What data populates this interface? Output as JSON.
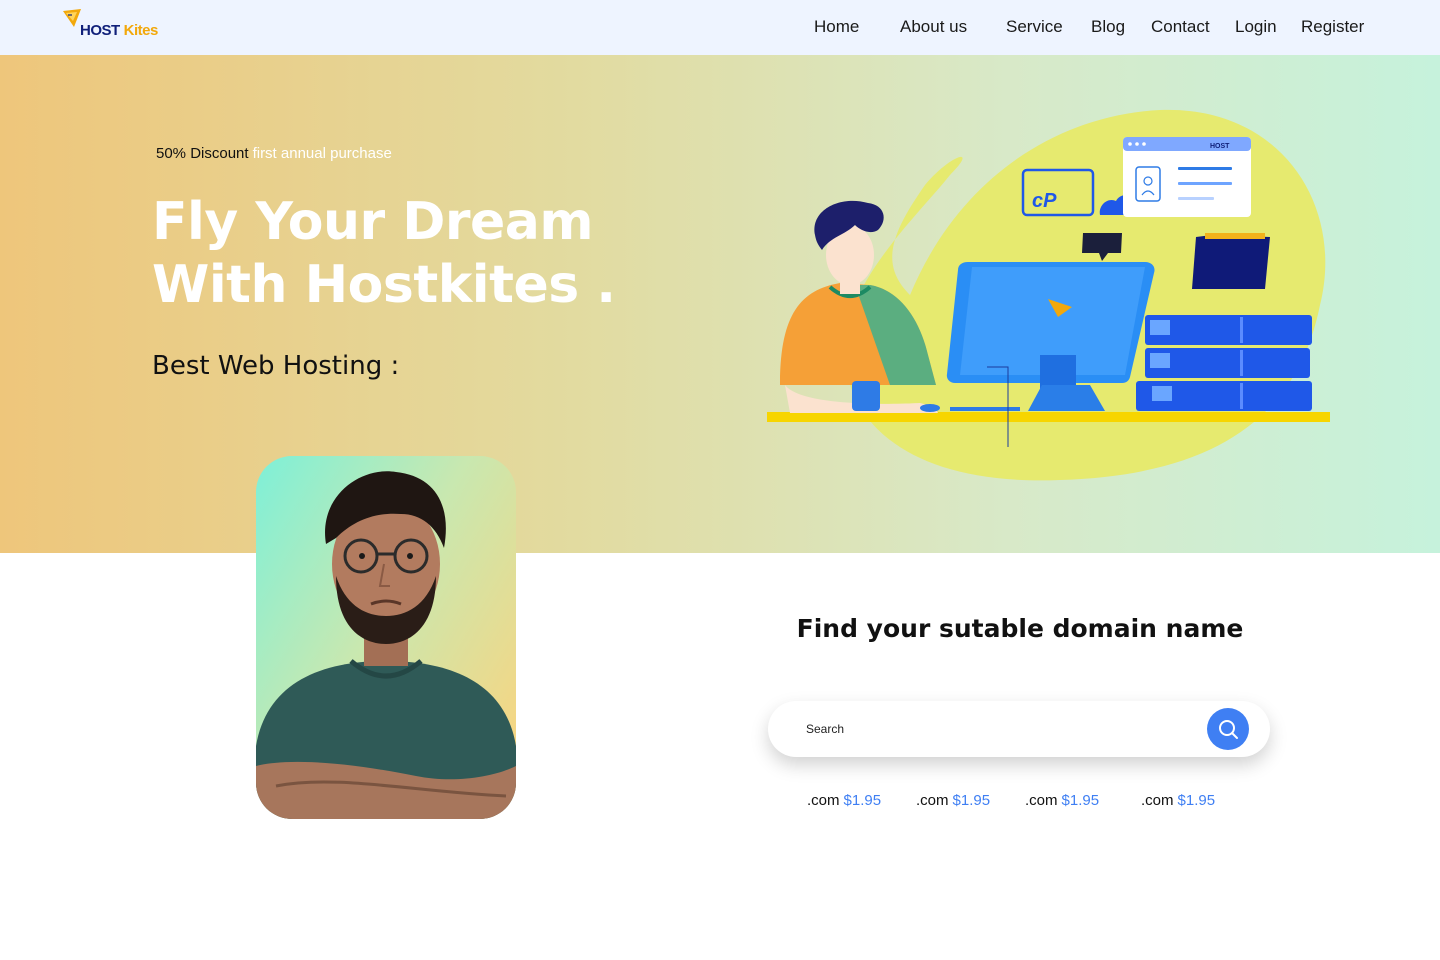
{
  "brand": {
    "logo_text_host": "HOST",
    "logo_text_kites": "Kites",
    "illus_logo_text": "HOST"
  },
  "nav": {
    "items": [
      {
        "label": "Home"
      },
      {
        "label": "About us"
      },
      {
        "label": "Service"
      },
      {
        "label": "Blog"
      },
      {
        "label": "Contact"
      },
      {
        "label": "Login"
      },
      {
        "label": "Register"
      }
    ]
  },
  "hero": {
    "promo_strong": "50% Discount",
    "promo_light": "first annual purchase",
    "title": "Fly Your Dream With Hostkites .",
    "subtitle": "Best Web Hosting :",
    "illustration_icons": {
      "cpanel": "cP"
    }
  },
  "domain": {
    "title": "Find your sutable domain name",
    "search_placeholder": "Search",
    "search_icon": "search-icon",
    "prices": [
      {
        "tld": ".com",
        "price": "$1.95"
      },
      {
        "tld": ".com",
        "price": "$1.95"
      },
      {
        "tld": ".com",
        "price": "$1.95"
      },
      {
        "tld": ".com",
        "price": "$1.95"
      }
    ]
  },
  "colors": {
    "nav_bg": "#eef4ff",
    "hero_gradient_start": "#eec67b",
    "hero_gradient_end": "#c6f2dc",
    "accent_blue": "#3f7ff3",
    "brand_navy": "#10207a",
    "brand_orange": "#f2a80b"
  }
}
